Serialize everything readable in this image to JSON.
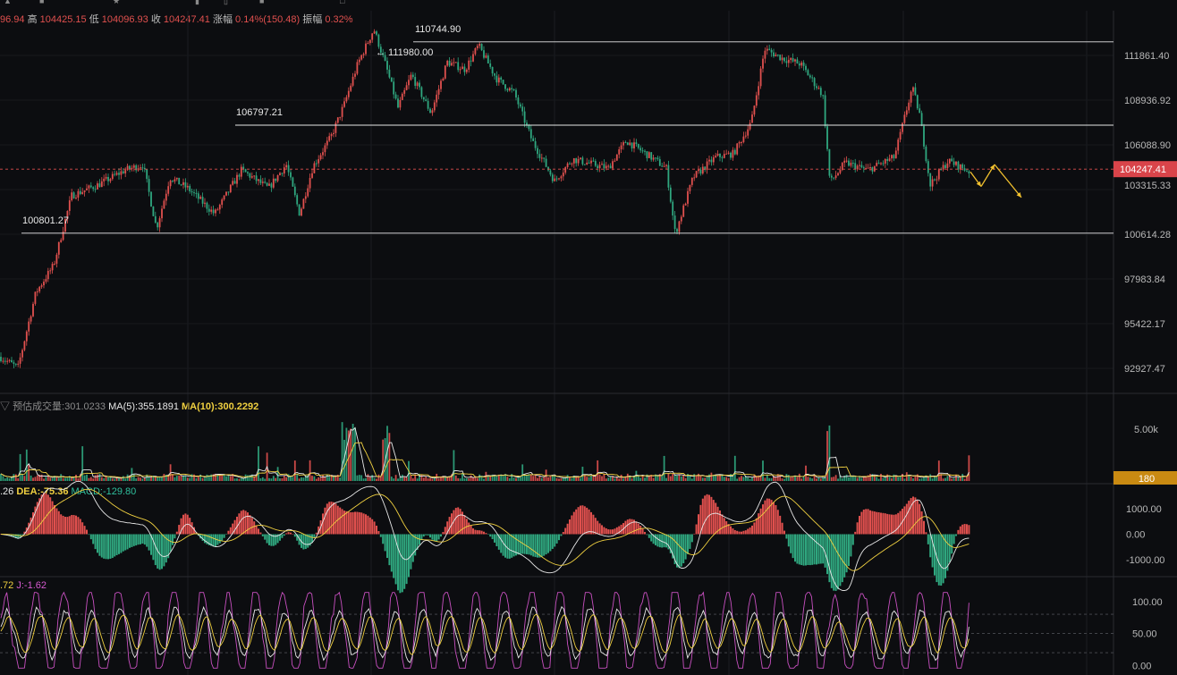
{
  "header": {
    "open_frag": "96.94",
    "high_label": "高",
    "high": "104425.15",
    "low_label": "低",
    "low": "104096.93",
    "close_label": "收",
    "close": "104247.41",
    "change_label": "涨幅",
    "change": "0.14%(150.48)",
    "amp_label": "振幅",
    "amp": "0.32%"
  },
  "price_panel": {
    "ylim": [
      92000,
      112900
    ],
    "ticks": [
      "111861.40",
      "108936.92",
      "106088.90",
      "103315.33",
      "100614.28",
      "97983.84",
      "95422.17",
      "92927.47"
    ],
    "current_price": "104247.41",
    "levels": [
      {
        "label": "110744.90",
        "value": 111200
      },
      {
        "label": "106797.21",
        "value": 106650
      },
      {
        "label": "100801.27",
        "value": 100750
      }
    ],
    "peak_label": "← 111980.00",
    "colors": {
      "up": "#e0504e",
      "down": "#2fa77f",
      "level": "#e6e6e6",
      "current": "#e0504e",
      "forecast": "#f2c12e"
    }
  },
  "volume_panel": {
    "label_est": "预估成交量:301.0233",
    "ma5": "MA(5):355.1891",
    "ma10": "MA(10):300.2292",
    "tick": "5.00k",
    "current": "180"
  },
  "macd_panel": {
    "dif_frag": ".26",
    "dea": "DEA:-75.36",
    "macd": "MACD:-129.80",
    "ticks": [
      "1000.00",
      "0.00",
      "-1000.00"
    ]
  },
  "kdj_panel": {
    "k_frag": ".72",
    "j": "J:-1.62",
    "ticks": [
      "100.00",
      "50.00",
      "0.00"
    ]
  },
  "chart_data": {
    "type": "candlestick",
    "price_path": [
      [
        0,
        94000
      ],
      [
        20,
        93400
      ],
      [
        40,
        97500
      ],
      [
        60,
        99000
      ],
      [
        80,
        102800
      ],
      [
        110,
        103400
      ],
      [
        140,
        104200
      ],
      [
        160,
        104500
      ],
      [
        175,
        101000
      ],
      [
        190,
        103800
      ],
      [
        210,
        103200
      ],
      [
        240,
        101800
      ],
      [
        270,
        104200
      ],
      [
        300,
        103200
      ],
      [
        320,
        104500
      ],
      [
        335,
        101800
      ],
      [
        350,
        104400
      ],
      [
        370,
        106000
      ],
      [
        385,
        107800
      ],
      [
        400,
        110000
      ],
      [
        418,
        111900
      ],
      [
        432,
        109800
      ],
      [
        445,
        107600
      ],
      [
        460,
        109400
      ],
      [
        482,
        107300
      ],
      [
        500,
        110100
      ],
      [
        520,
        109700
      ],
      [
        535,
        111000
      ],
      [
        555,
        109200
      ],
      [
        575,
        108400
      ],
      [
        595,
        105800
      ],
      [
        620,
        103600
      ],
      [
        640,
        104800
      ],
      [
        680,
        104300
      ],
      [
        700,
        105800
      ],
      [
        725,
        105000
      ],
      [
        745,
        104300
      ],
      [
        755,
        100700
      ],
      [
        775,
        103800
      ],
      [
        800,
        104900
      ],
      [
        820,
        105100
      ],
      [
        840,
        106800
      ],
      [
        855,
        110800
      ],
      [
        875,
        110300
      ],
      [
        895,
        110000
      ],
      [
        920,
        108300
      ],
      [
        928,
        103500
      ],
      [
        945,
        104600
      ],
      [
        970,
        104200
      ],
      [
        1000,
        104900
      ],
      [
        1020,
        108700
      ],
      [
        1028,
        107300
      ],
      [
        1040,
        103400
      ],
      [
        1060,
        104700
      ],
      [
        1085,
        104100
      ]
    ],
    "forecast": [
      [
        1085,
        104100
      ],
      [
        1097,
        103300
      ],
      [
        1112,
        104500
      ],
      [
        1142,
        102700
      ]
    ],
    "volume_ylim": [
      0,
      6500
    ],
    "macd_ylim": [
      -1500,
      1500
    ],
    "kdj_ylim": [
      -5,
      115
    ],
    "kdj_levels": [
      80,
      50,
      20
    ]
  }
}
